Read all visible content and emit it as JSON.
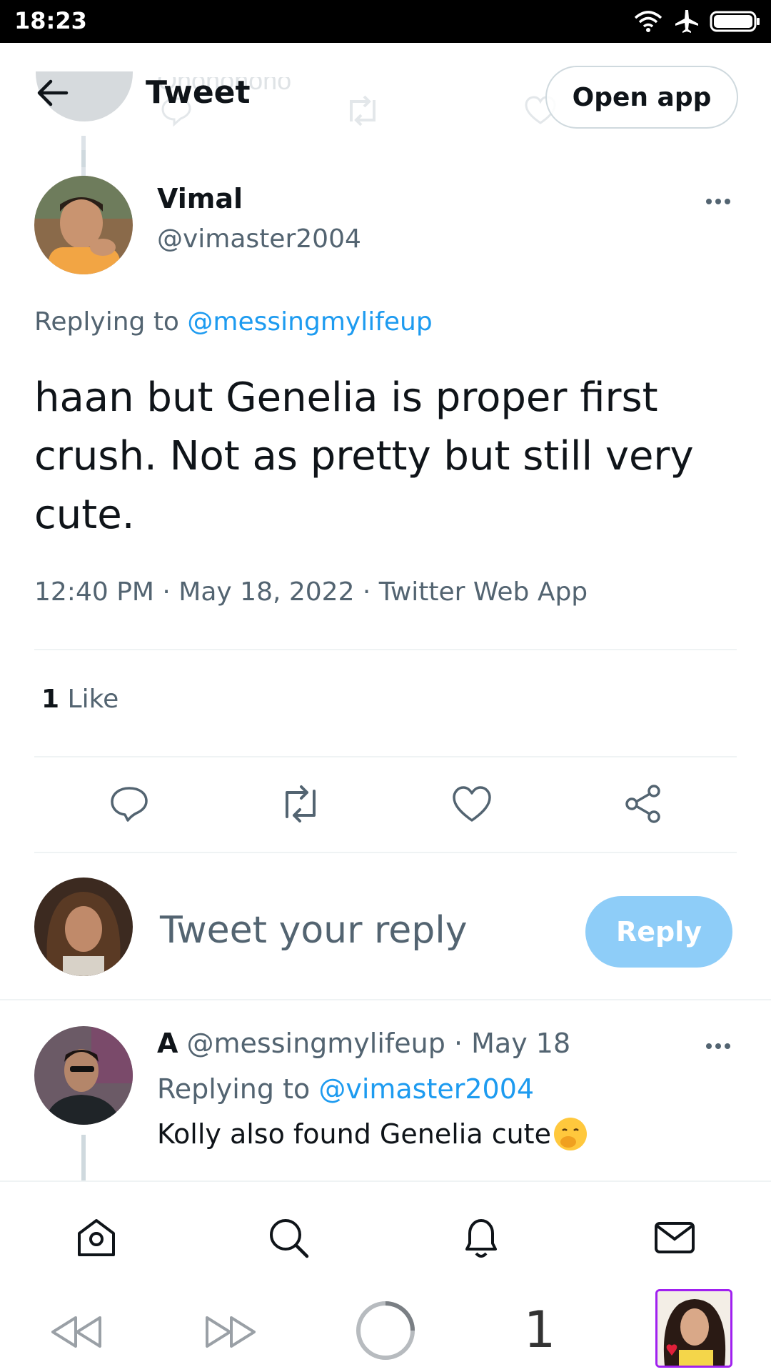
{
  "status_bar": {
    "time": "18:23"
  },
  "header": {
    "behind_text": "Ohohohoho",
    "title": "Tweet",
    "open_app_label": "Open app"
  },
  "tweet": {
    "author_name": "Vimal",
    "author_handle": "@vimaster2004",
    "replying_prefix": "Replying to",
    "replying_handle": "@messingmylifeup",
    "text": "haan but Genelia is proper first crush. Not as pretty but still very cute.",
    "meta": "12:40 PM · May 18, 2022 · Twitter Web App",
    "likes_count": "1",
    "likes_label": "Like"
  },
  "composer": {
    "placeholder": "Tweet your reply",
    "reply_label": "Reply"
  },
  "reply": {
    "author_name": "A",
    "author_handle": "@messingmylifeup",
    "separator": "·",
    "date": "May 18",
    "replying_prefix": "Replying to",
    "replying_handle": "@vimaster2004",
    "text": "Kolly also found Genelia cute"
  },
  "browser": {
    "tab_count": "1"
  },
  "colors": {
    "accent": "#1d9bf0",
    "reply_button": "#8ecdf8",
    "text": "#0f1419",
    "muted": "#536471"
  },
  "icons": {
    "back": "arrow-left-icon",
    "more": "more-icon",
    "actions": [
      "comment-icon",
      "retweet-icon",
      "heart-icon",
      "share-icon"
    ],
    "nav": [
      "home-icon",
      "search-icon",
      "bell-icon",
      "mail-icon"
    ],
    "browser": [
      "rewind-icon",
      "forward-icon",
      "loading-icon"
    ]
  }
}
